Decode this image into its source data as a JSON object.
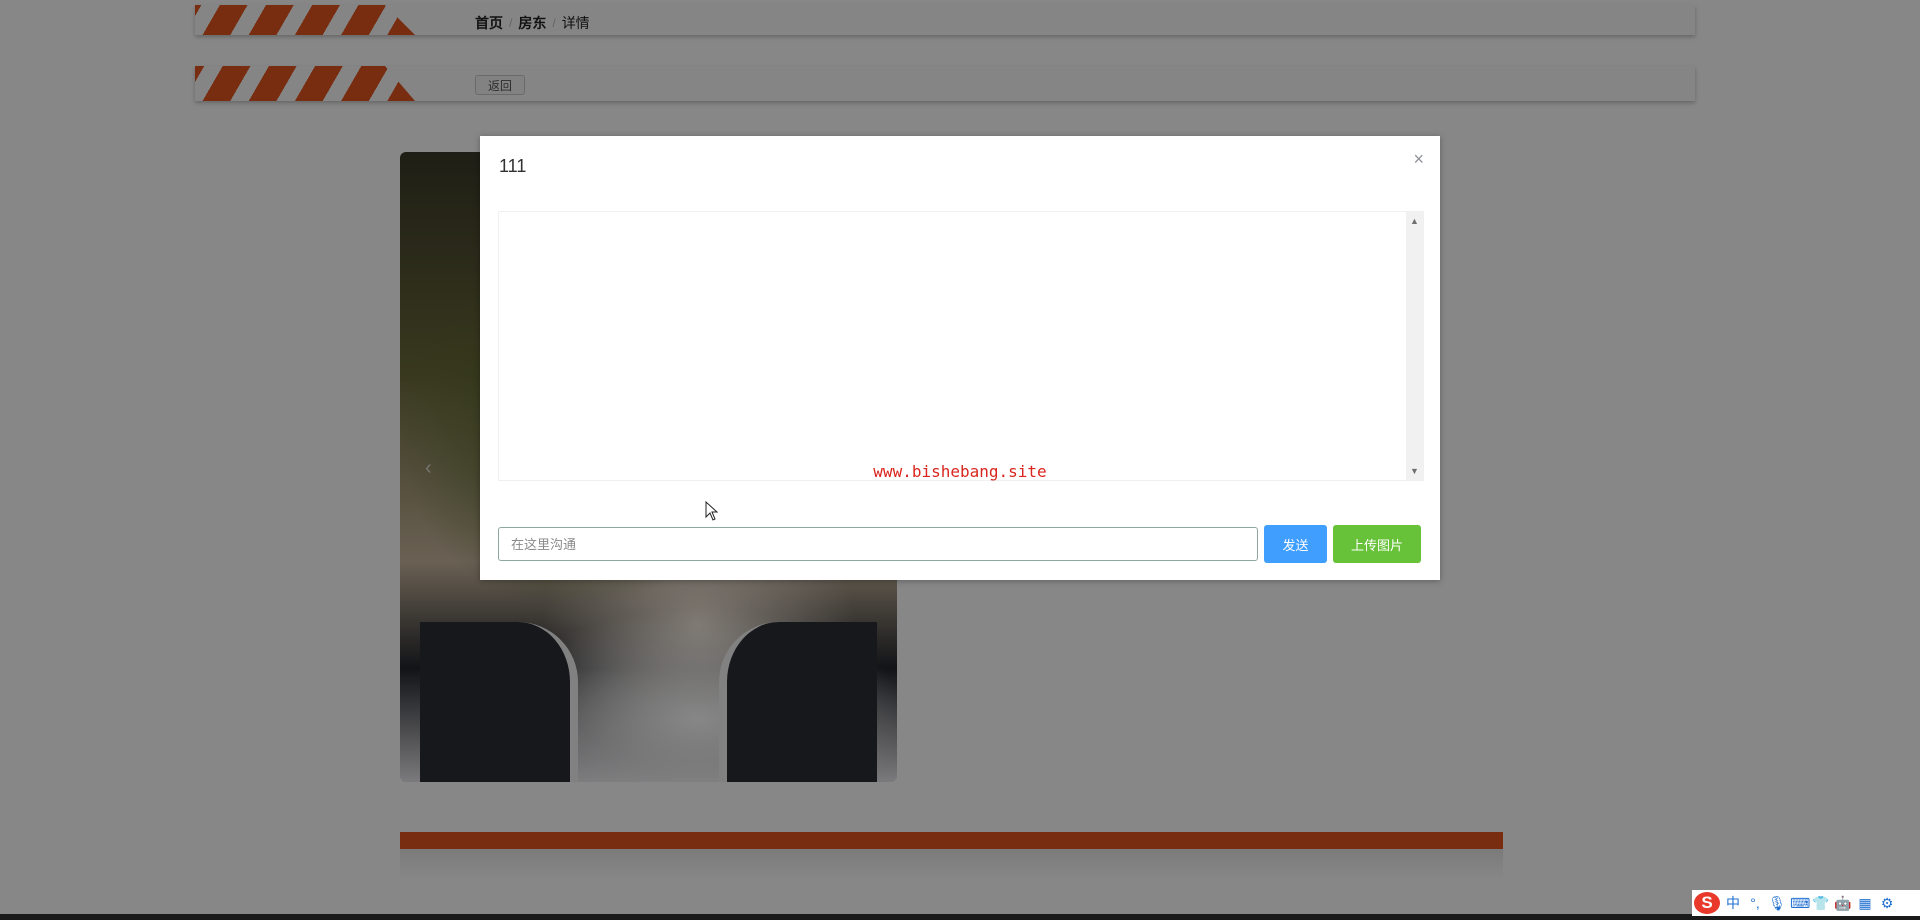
{
  "nav": {
    "breadcrumb": [
      {
        "label": "首页"
      },
      {
        "label": "房东"
      },
      {
        "label": "详情"
      }
    ],
    "separator": "/"
  },
  "subbar": {
    "back_label": "返回"
  },
  "carousel": {
    "prev_glyph": "‹"
  },
  "dialog": {
    "title": "111",
    "close_glyph": "×",
    "watermark": "www.bishebang.site",
    "input": {
      "placeholder": "在这里沟通",
      "value": ""
    },
    "send_label": "发送",
    "upload_label": "上传图片"
  },
  "ime": {
    "logo": "S",
    "items": [
      {
        "glyph": "中",
        "icon": "chinese-mode-icon"
      },
      {
        "glyph": "°,",
        "icon": "punctuation-icon"
      },
      {
        "glyph": "🎙",
        "icon": "microphone-icon"
      },
      {
        "glyph": "⌨",
        "icon": "keyboard-icon"
      },
      {
        "glyph": "👕",
        "icon": "skin-icon"
      },
      {
        "glyph": "🤖",
        "icon": "assistant-icon"
      },
      {
        "glyph": "▦",
        "icon": "toolbox-icon"
      },
      {
        "glyph": "⚙",
        "icon": "settings-icon"
      }
    ]
  },
  "colors": {
    "accent_orange": "#e2561f",
    "send_blue": "#409eff",
    "upload_green": "#67c23a",
    "watermark_red": "#d9251d"
  }
}
